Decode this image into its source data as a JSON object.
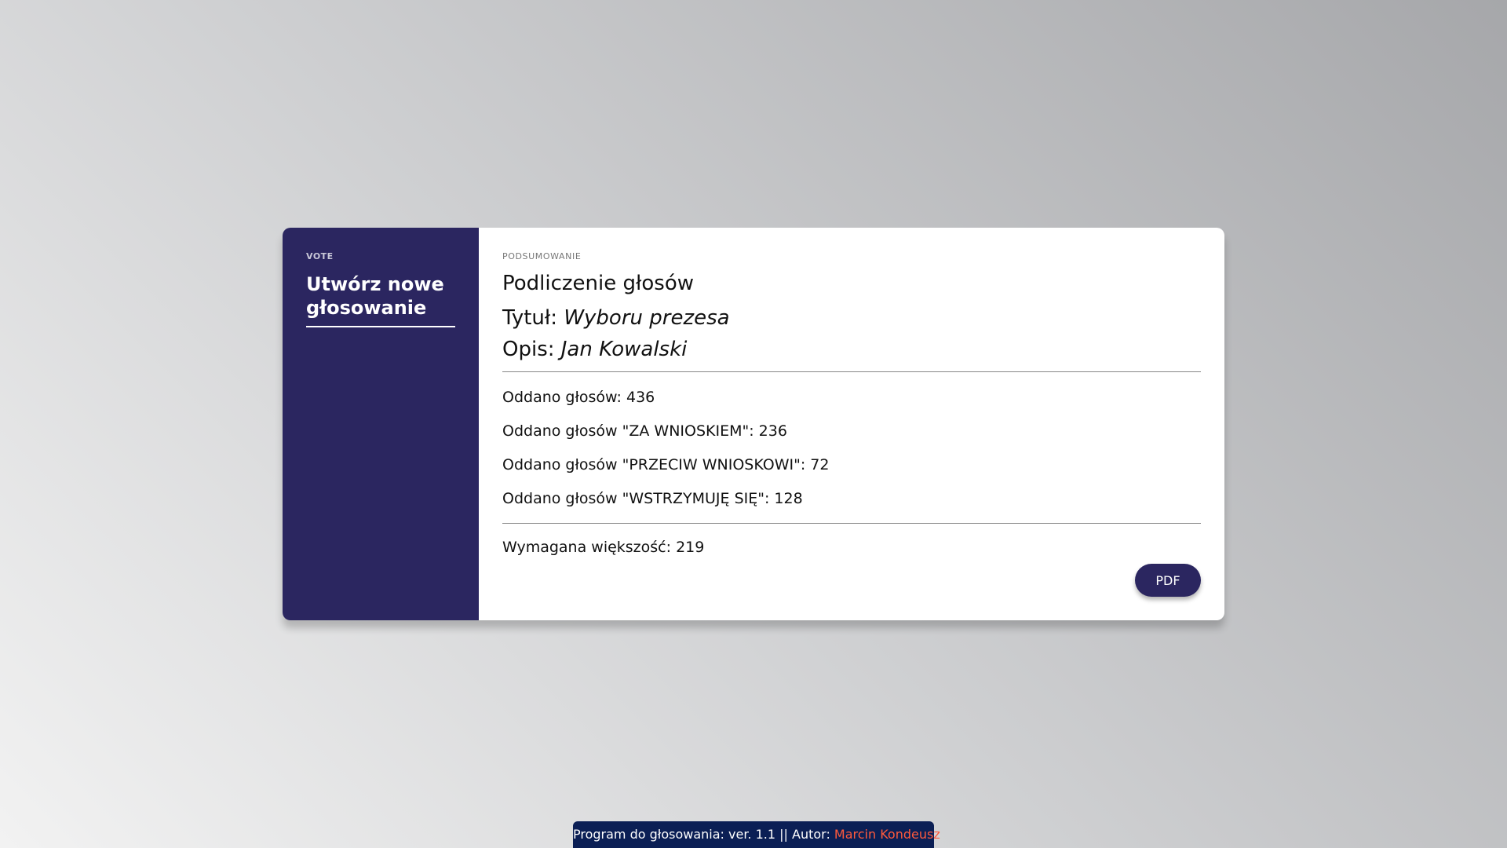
{
  "sidebar": {
    "eyebrow": "VOTE",
    "create_label": "Utwórz nowe głosowanie"
  },
  "summary": {
    "eyebrow": "PODSUMOWANIE",
    "heading": "Podliczenie głosów",
    "title_label": "Tytuł:",
    "title_value": "Wyboru prezesa",
    "desc_label": "Opis:",
    "desc_value": "Jan Kowalski",
    "stats": [
      "Oddano głosów: 436",
      "Oddano głosów \"ZA WNIOSKIEM\": 236",
      "Oddano głosów \"PRZECIW WNIOSKOWI\": 72",
      "Oddano głosów \"WSTRZYMUJĘ SIĘ\": 128"
    ],
    "majority": "Wymagana większość: 219",
    "pdf_label": "PDF"
  },
  "footer": {
    "text": "Program do głosowania: ver. 1.1 || Autor:",
    "author": "Marcin Kondeusz"
  },
  "colors": {
    "sidebar_bg": "#2b2660",
    "footer_bg": "#0b1f55",
    "author_link": "#ff5a3c"
  }
}
